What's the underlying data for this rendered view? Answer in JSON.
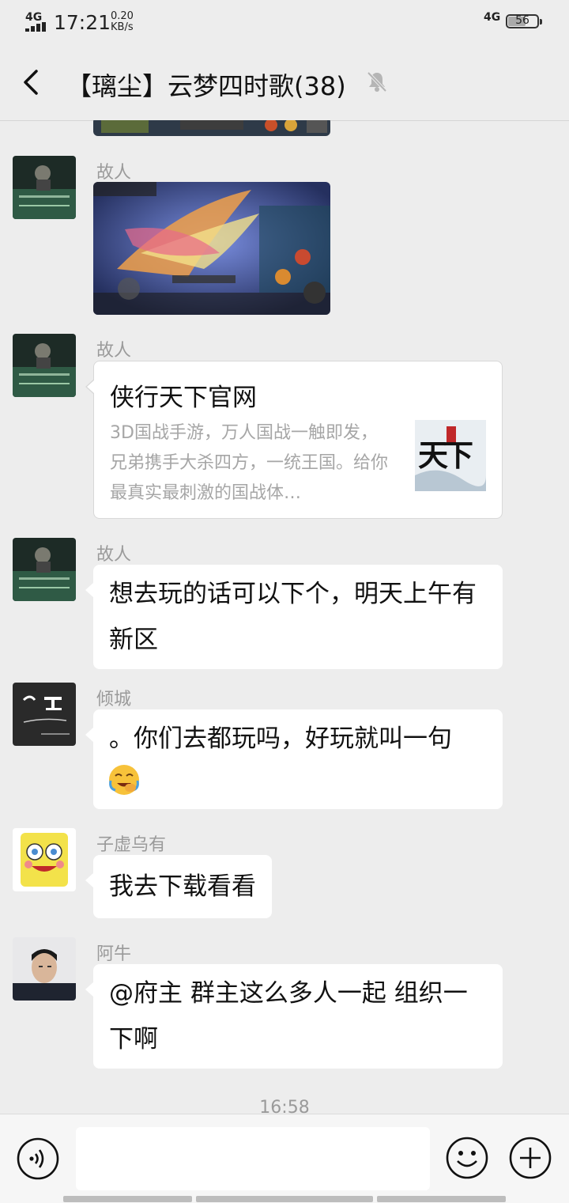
{
  "status_bar": {
    "network": "4G",
    "time": "17:21",
    "speed_value": "0.20",
    "speed_unit": "KB/s",
    "network_right": "4G",
    "battery": "56"
  },
  "header": {
    "title": "【璃尘】云梦四时歌(38)"
  },
  "messages": [
    {
      "sender": "故人",
      "type": "image"
    },
    {
      "sender": "故人",
      "type": "link",
      "link_title": "侠行天下官网",
      "link_desc": "3D国战手游，万人国战一触即发，兄弟携手大杀四方，一统王国。给你最真实最刺激的国战体…",
      "thumb_text": "天下"
    },
    {
      "sender": "故人",
      "type": "text",
      "text": "想去玩的话可以下个，明天上午有新区"
    },
    {
      "sender": "倾城",
      "type": "text",
      "text": "。你们去都玩吗，好玩就叫一句"
    },
    {
      "sender": "子虚乌有",
      "type": "text",
      "text": "我去下载看看"
    },
    {
      "sender": "阿牛",
      "type": "text",
      "text": "@府主 群主这么多人一起 组织一下啊"
    }
  ],
  "timestamp": "16:58",
  "icons": {
    "back": "back-arrow-icon",
    "mute": "mute-bell-icon",
    "voice": "voice-icon",
    "emoji": "emoji-icon",
    "plus": "plus-icon",
    "face": "facepalm-emoji-icon"
  },
  "colors": {
    "background": "#ededed",
    "bubble": "#ffffff",
    "sender": "#9a9a9a",
    "link_desc": "#a6a6a6"
  }
}
